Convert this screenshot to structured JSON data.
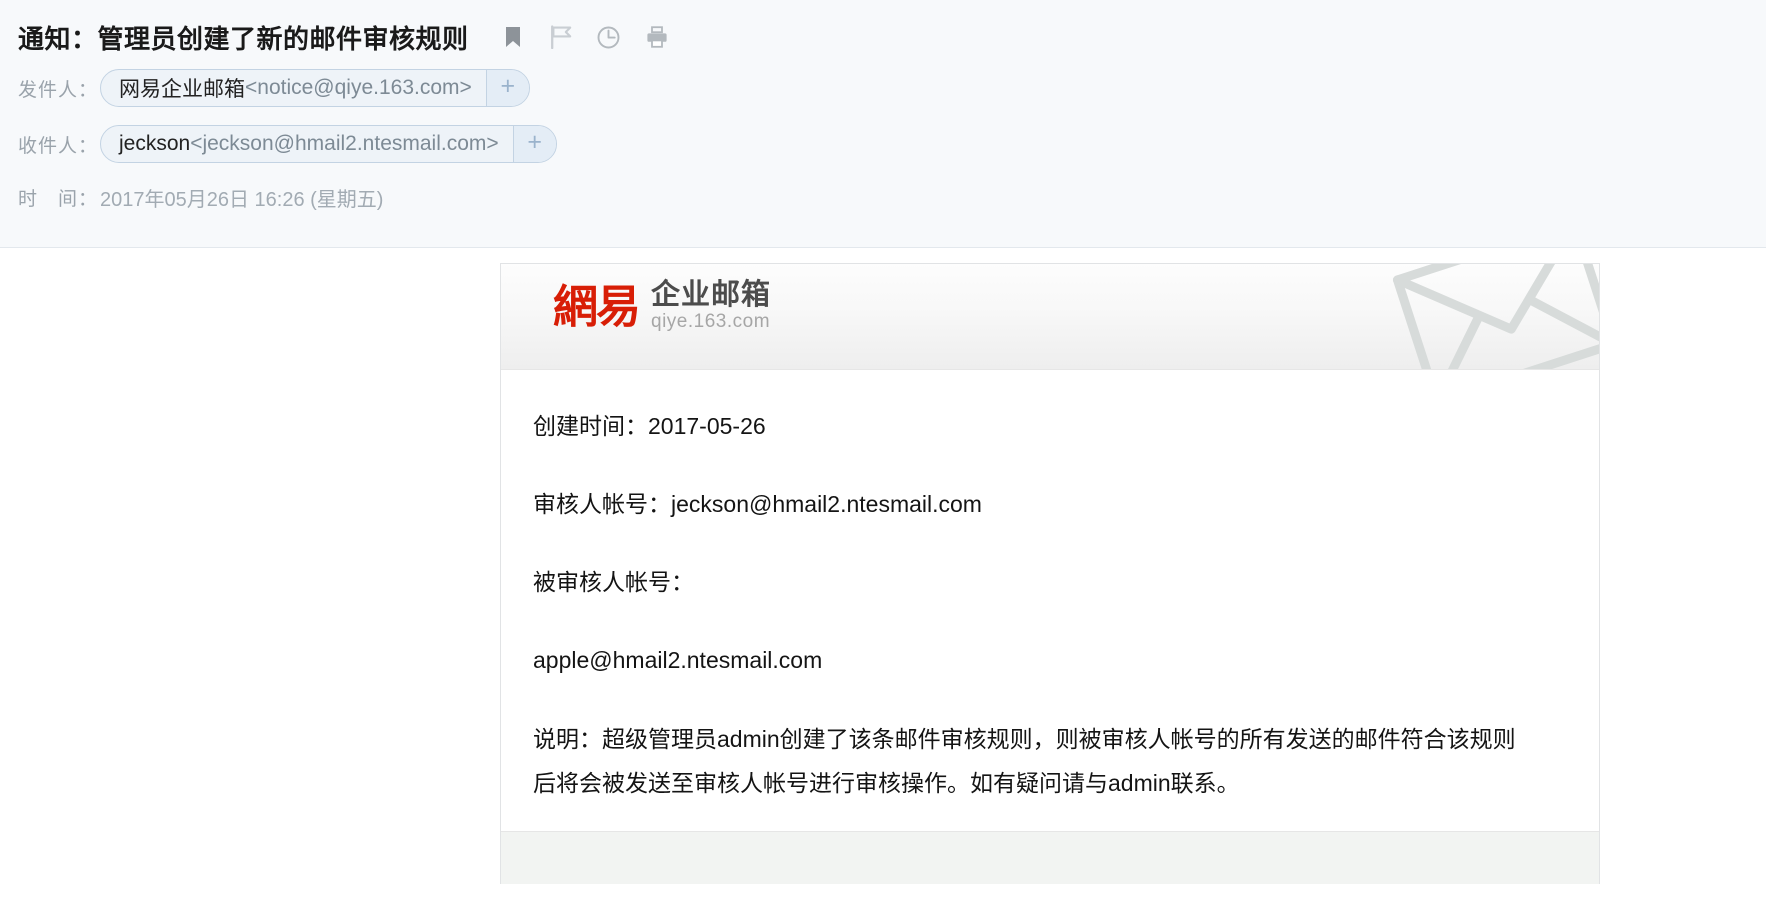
{
  "header": {
    "subject": "通知：管理员创建了新的邮件审核规则",
    "icons": [
      {
        "name": "bookmark-icon",
        "title": "标记"
      },
      {
        "name": "flag-icon",
        "title": "红旗标记"
      },
      {
        "name": "clock-icon",
        "title": "稍后处理"
      },
      {
        "name": "printer-icon",
        "title": "打印"
      }
    ],
    "from": {
      "label": "发件人：",
      "name": "网易企业邮箱",
      "email": "<notice@qiye.163.com>",
      "add_label": "+"
    },
    "to": {
      "label": "收件人：",
      "name": "jeckson",
      "email": "<jeckson@hmail2.ntesmail.com>",
      "add_label": "+"
    },
    "time": {
      "label": "时　间：",
      "value": "2017年05月26日 16:26 (星期五)"
    }
  },
  "card": {
    "brand": {
      "cn": "網易",
      "product": "企业邮箱",
      "domain": "qiye.163.com"
    },
    "watermark": "envelope-watermark",
    "paragraphs": [
      "创建时间：2017-05-26",
      "审核人帐号：jeckson@hmail2.ntesmail.com",
      "被审核人帐号：",
      "apple@hmail2.ntesmail.com",
      "说明：超级管理员admin创建了该条邮件审核规则，则被审核人帐号的所有发送的邮件符合该规则后将会被发送至审核人帐号进行审核操作。如有疑问请与admin联系。"
    ]
  },
  "colors": {
    "brand_red": "#d81e06",
    "pill_bg": "#eef3f8",
    "pill_border": "#c3d3e3",
    "header_bg": "#f7f9fb",
    "muted_text": "#9aa3ab"
  }
}
